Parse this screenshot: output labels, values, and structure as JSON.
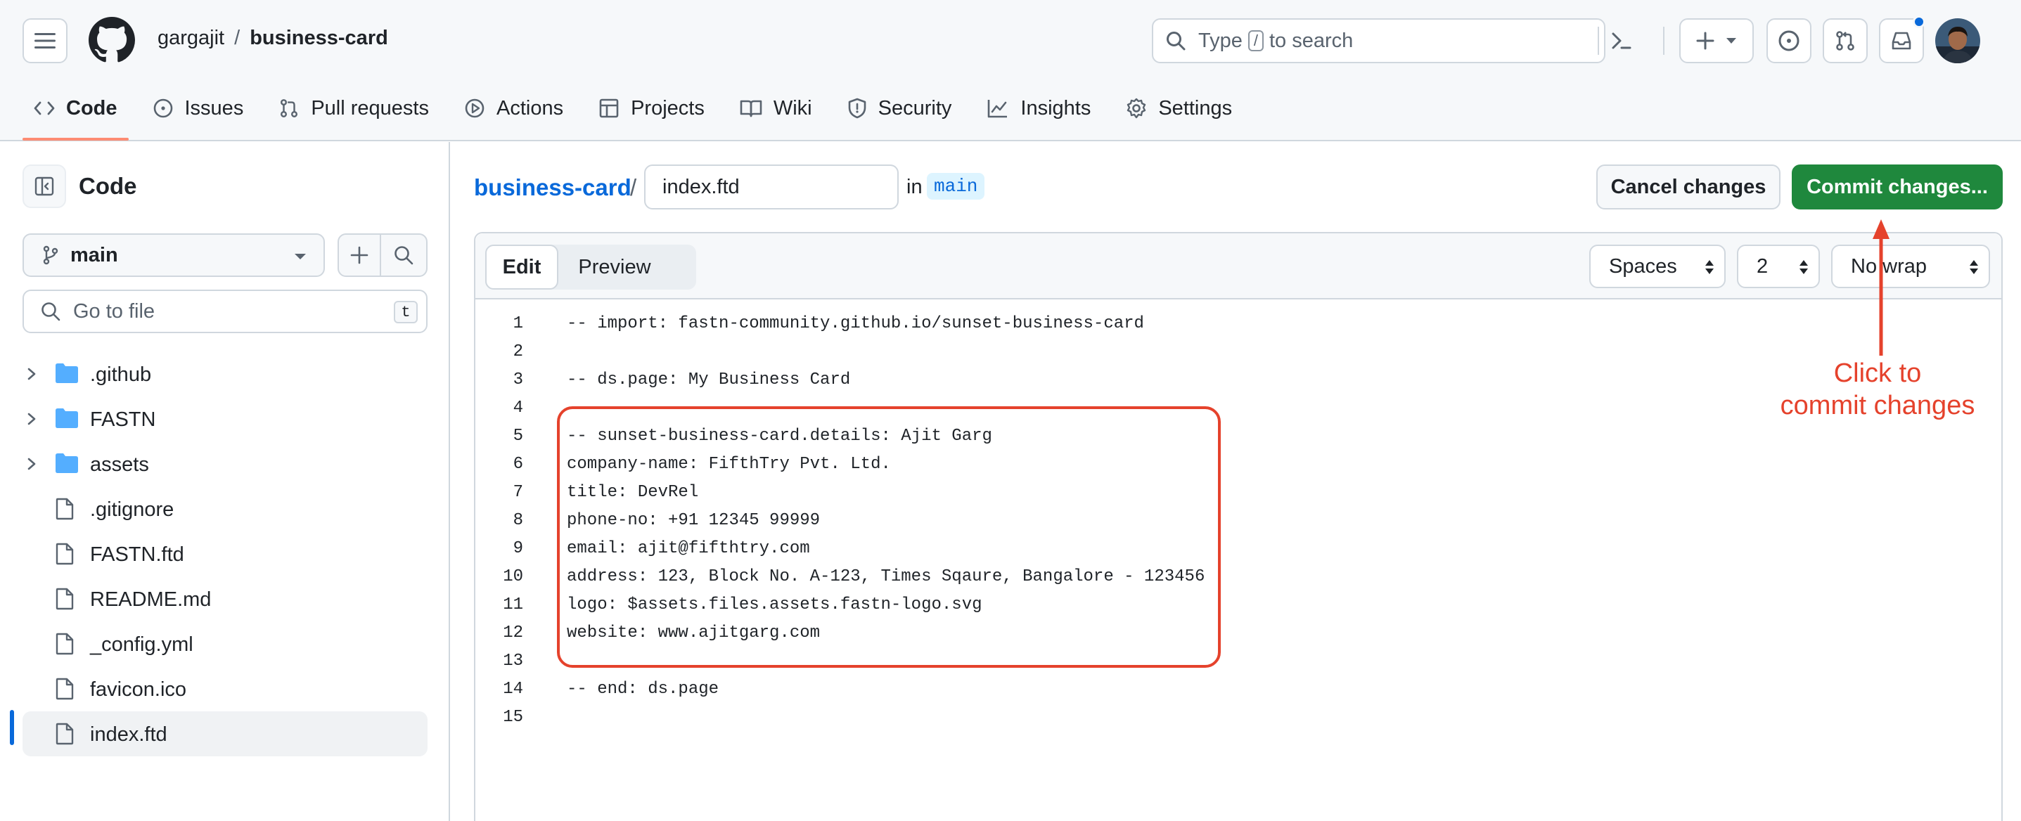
{
  "header": {
    "owner": "gargajit",
    "separator": "/",
    "repo": "business-card",
    "search_placeholder_prefix": "Type",
    "search_key": "/",
    "search_placeholder_suffix": "to search"
  },
  "repo_nav": [
    {
      "label": "Code",
      "icon": "code-icon",
      "active": true
    },
    {
      "label": "Issues",
      "icon": "issue-opened-icon"
    },
    {
      "label": "Pull requests",
      "icon": "git-pull-request-icon"
    },
    {
      "label": "Actions",
      "icon": "play-icon"
    },
    {
      "label": "Projects",
      "icon": "table-icon"
    },
    {
      "label": "Wiki",
      "icon": "book-icon"
    },
    {
      "label": "Security",
      "icon": "shield-icon"
    },
    {
      "label": "Insights",
      "icon": "graph-icon"
    },
    {
      "label": "Settings",
      "icon": "gear-icon"
    }
  ],
  "sidebar": {
    "title": "Code",
    "branch": "main",
    "goto_placeholder": "Go to file",
    "goto_key": "t",
    "files": [
      {
        "name": ".github",
        "type": "folder"
      },
      {
        "name": "FASTN",
        "type": "folder"
      },
      {
        "name": "assets",
        "type": "folder"
      },
      {
        "name": ".gitignore",
        "type": "file"
      },
      {
        "name": "FASTN.ftd",
        "type": "file"
      },
      {
        "name": "README.md",
        "type": "file"
      },
      {
        "name": "_config.yml",
        "type": "file"
      },
      {
        "name": "favicon.ico",
        "type": "file"
      },
      {
        "name": "index.ftd",
        "type": "file",
        "selected": true
      }
    ]
  },
  "main": {
    "breadcrumb_repo": "business-card",
    "breadcrumb_sep": "/",
    "filename": "index.ftd",
    "in_label": "in",
    "branch": "main",
    "cancel_label": "Cancel changes",
    "commit_label": "Commit changes..."
  },
  "editor": {
    "tabs": {
      "edit": "Edit",
      "preview": "Preview"
    },
    "indent_mode": "Spaces",
    "indent_size": "2",
    "wrap_mode": "No wrap",
    "lines": [
      "-- import: fastn-community.github.io/sunset-business-card",
      "",
      "-- ds.page: My Business Card",
      "",
      "-- sunset-business-card.details: Ajit Garg",
      "company-name: FifthTry Pvt. Ltd.",
      "title: DevRel",
      "phone-no: +91 12345 99999",
      "email: ajit@fifthtry.com",
      "address: 123, Block No. A-123, Times Sqaure, Bangalore - 123456",
      "logo: $assets.files.assets.fastn-logo.svg",
      "website: www.ajitgarg.com",
      "",
      "-- end: ds.page",
      ""
    ]
  },
  "annotation": {
    "line1": "Click to",
    "line2": "commit changes",
    "color": "#e5422c"
  },
  "colors": {
    "primary_button": "#1f883d",
    "link": "#0969da",
    "active_tab_underline": "#fd8c73",
    "folder": "#54aeff"
  }
}
